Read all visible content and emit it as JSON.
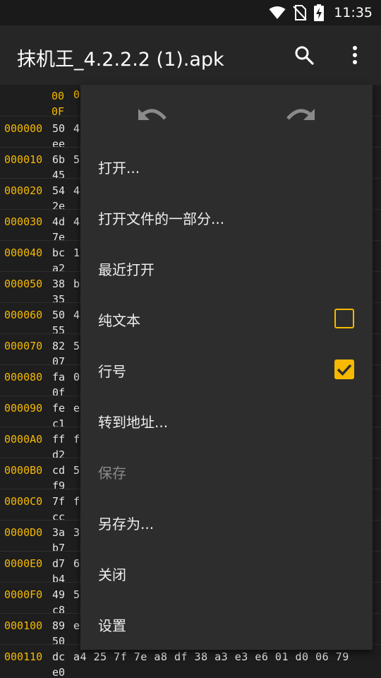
{
  "status": {
    "time": "11:35"
  },
  "appbar": {
    "title": "抹机王_4.2.2.2 (1).apk",
    "search_icon": "search-icon",
    "more_icon": "more-vert-icon"
  },
  "hex": {
    "header": {
      "col0_top": "00",
      "col0_bottom": "0F",
      "col1": "0"
    },
    "rows": [
      {
        "addr": "000000",
        "b0": "50",
        "b1": "4",
        "b2": "ee"
      },
      {
        "addr": "000010",
        "b0": "6b",
        "b1": "5",
        "b2": "45"
      },
      {
        "addr": "000020",
        "b0": "54",
        "b1": "4",
        "b2": "2e"
      },
      {
        "addr": "000030",
        "b0": "4d",
        "b1": "4",
        "b2": "7e"
      },
      {
        "addr": "000040",
        "b0": "bc",
        "b1": "1",
        "b2": "a2"
      },
      {
        "addr": "000050",
        "b0": "38",
        "b1": "b",
        "b2": "35"
      },
      {
        "addr": "000060",
        "b0": "50",
        "b1": "4",
        "b2": "55"
      },
      {
        "addr": "000070",
        "b0": "82",
        "b1": "5",
        "b2": "07"
      },
      {
        "addr": "000080",
        "b0": "fa",
        "b1": "0",
        "b2": "0f"
      },
      {
        "addr": "000090",
        "b0": "fe",
        "b1": "e",
        "b2": "c1"
      },
      {
        "addr": "0000A0",
        "b0": "ff",
        "b1": "f",
        "b2": "d2"
      },
      {
        "addr": "0000B0",
        "b0": "cd",
        "b1": "5",
        "b2": "f9"
      },
      {
        "addr": "0000C0",
        "b0": "7f",
        "b1": "f",
        "b2": "cc"
      },
      {
        "addr": "0000D0",
        "b0": "3a",
        "b1": "3",
        "b2": "b7"
      },
      {
        "addr": "0000E0",
        "b0": "d7",
        "b1": "6",
        "b2": "b4"
      },
      {
        "addr": "0000F0",
        "b0": "49",
        "b1": "5",
        "b2": "c8"
      },
      {
        "addr": "000100",
        "b0": "89",
        "b1": "e",
        "b2": "50"
      }
    ],
    "last_row": {
      "addr": "000110",
      "b0": "dc",
      "rest": "a4 25 7f 7e a8 df 38 a3 e3 e6 01 d0 06 79",
      "b2": "e0"
    }
  },
  "menu": {
    "undo_icon": "undo-icon",
    "redo_icon": "redo-icon",
    "items": [
      {
        "label": "打开..."
      },
      {
        "label": "打开文件的一部分..."
      },
      {
        "label": "最近打开"
      },
      {
        "label": "纯文本",
        "checked": false
      },
      {
        "label": "行号",
        "checked": true
      },
      {
        "label": "转到地址..."
      },
      {
        "label": "保存",
        "disabled": true
      },
      {
        "label": "另存为..."
      },
      {
        "label": "关闭"
      },
      {
        "label": "设置"
      }
    ]
  },
  "colors": {
    "accent": "#f6b900",
    "background": "#1e1e1e",
    "menu_bg": "#2d2d2d",
    "appbar_bg": "#262626"
  }
}
